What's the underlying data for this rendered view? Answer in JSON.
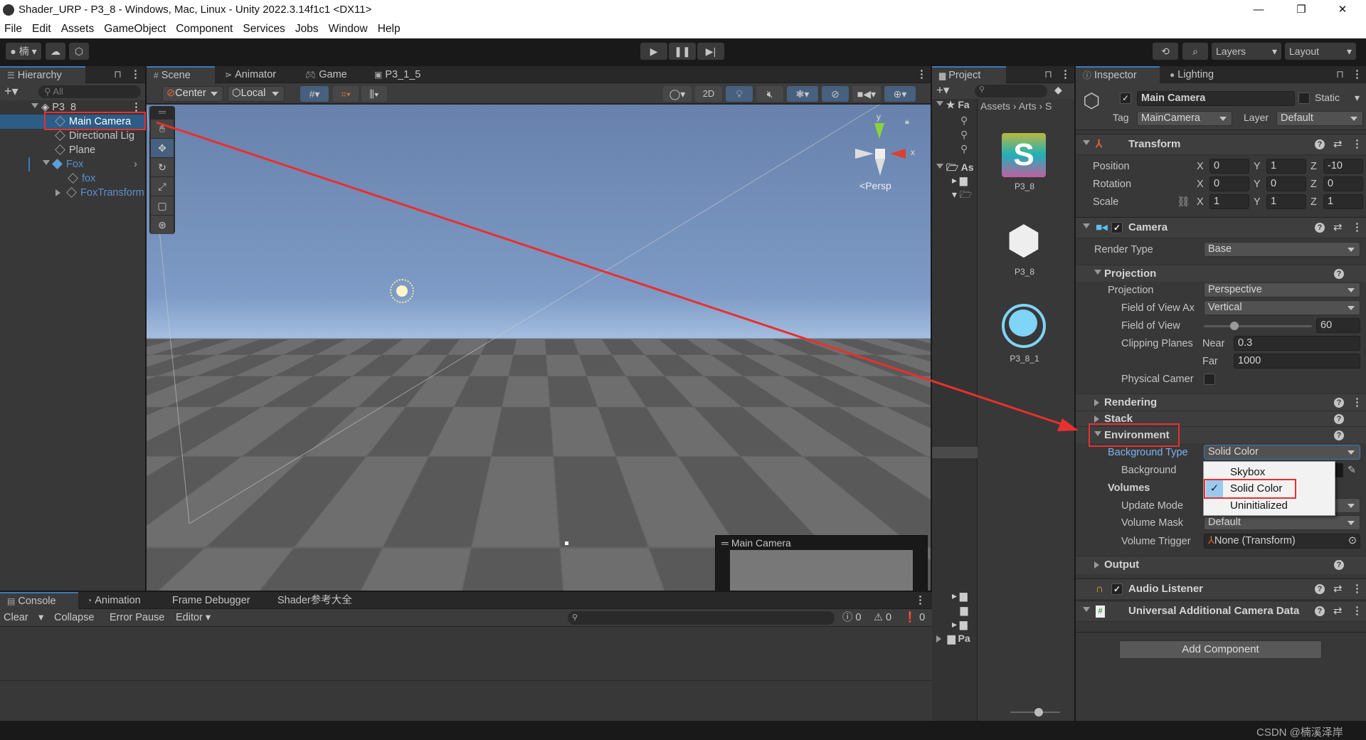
{
  "window": {
    "title": "Shader_URP - P3_8 - Windows, Mac, Linux - Unity 2022.3.14f1c1 <DX11>",
    "minimize": "—",
    "maximize": "❐",
    "close": "✕"
  },
  "menu": [
    "File",
    "Edit",
    "Assets",
    "GameObject",
    "Component",
    "Services",
    "Jobs",
    "Window",
    "Help"
  ],
  "toolbar": {
    "account_label": "楠",
    "layers_label": "Layers",
    "layout_label": "Layout"
  },
  "hierarchy": {
    "tab": "Hierarchy",
    "search_placeholder": "All",
    "scene": "P3_8",
    "items": [
      {
        "label": "Main Camera",
        "selected": true
      },
      {
        "label": "Directional Lig"
      },
      {
        "label": "Plane"
      },
      {
        "label": "Fox",
        "prefab": true
      },
      {
        "label": "fox",
        "prefab": true
      },
      {
        "label": "FoxTransform",
        "prefab": true
      }
    ]
  },
  "scene": {
    "tabs": [
      "Scene",
      "Animator",
      "Game",
      "P3_1_5"
    ],
    "pivot_label": "Center",
    "space_label": "Local",
    "mode_2d": "2D",
    "gizmo_persp": "Persp",
    "gizmo_y": "y",
    "gizmo_x": "x",
    "camera_preview_title": "Main Camera"
  },
  "project": {
    "tab": "Project",
    "tree_favorites": "Fa",
    "tree_assets": "As",
    "tree_packages": "Pa",
    "breadcrumb": [
      "Assets",
      "Arts",
      "S"
    ],
    "assets": [
      {
        "name": "P3_8",
        "type": "shader"
      },
      {
        "name": "P3_8",
        "type": "prefab"
      },
      {
        "name": "P3_8_1",
        "type": "material"
      }
    ]
  },
  "inspector": {
    "tabs": [
      "Inspector",
      "Lighting"
    ],
    "object_name": "Main Camera",
    "static_label": "Static",
    "tag_label": "Tag",
    "tag_value": "MainCamera",
    "layer_label": "Layer",
    "layer_value": "Default",
    "transform": {
      "title": "Transform",
      "position": {
        "label": "Position",
        "x": "0",
        "y": "1",
        "z": "-10"
      },
      "rotation": {
        "label": "Rotation",
        "x": "0",
        "y": "0",
        "z": "0"
      },
      "scale": {
        "label": "Scale",
        "x": "1",
        "y": "1",
        "z": "1"
      }
    },
    "camera": {
      "title": "Camera",
      "render_type_label": "Render Type",
      "render_type": "Base",
      "projection_section": "Projection",
      "projection_label": "Projection",
      "projection": "Perspective",
      "fov_axis_label": "Field of View Ax",
      "fov_axis": "Vertical",
      "fov_label": "Field of View",
      "fov": "60",
      "fov_fraction": 0.28,
      "clipping_label": "Clipping Planes",
      "near_label": "Near",
      "near": "0.3",
      "far_label": "Far",
      "far": "1000",
      "physical_label": "Physical Camer",
      "rendering_section": "Rendering",
      "stack_section": "Stack",
      "environment_section": "Environment",
      "bg_type_label": "Background Type",
      "bg_type": "Solid Color",
      "background_label": "Background",
      "volumes_label": "Volumes",
      "update_mode_label": "Update Mode",
      "volume_mask_label": "Volume Mask",
      "volume_mask": "Default",
      "volume_trigger_label": "Volume Trigger",
      "volume_trigger": "None (Transform)",
      "output_section": "Output"
    },
    "bg_type_options": [
      {
        "label": "Skybox",
        "checked": false
      },
      {
        "label": "Solid Color",
        "checked": true
      },
      {
        "label": "Uninitialized",
        "checked": false
      }
    ],
    "audio_listener": "Audio Listener",
    "uacd": "Universal Additional Camera Data",
    "add_component": "Add Component"
  },
  "console": {
    "tabs": [
      "Console",
      "Animation",
      "Frame Debugger",
      "Shader参考大全"
    ],
    "clear": "Clear",
    "collapse": "Collapse",
    "error_pause": "Error Pause",
    "editor": "Editor",
    "log_count": "0",
    "warn_count": "0",
    "error_count": "0"
  },
  "watermark": "CSDN @楠溪泽岸",
  "colors": {
    "accent": "#3a79bb",
    "annotation": "#e8302f",
    "selection": "#2c5d87"
  }
}
